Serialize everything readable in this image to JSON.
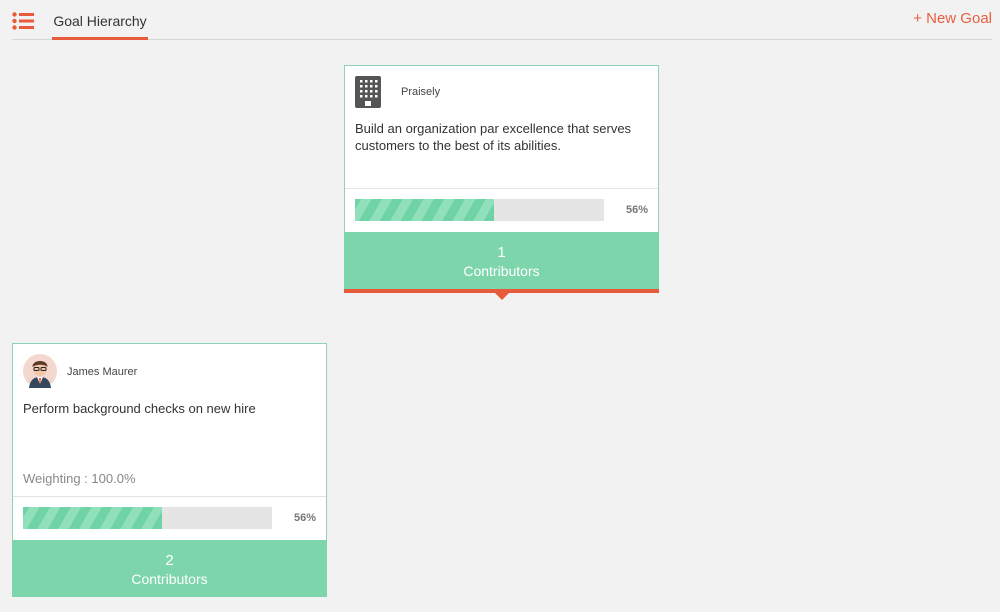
{
  "header": {
    "menu_icon": "list-icon",
    "tab_label": "Goal Hierarchy",
    "new_goal_label": "+ New Goal",
    "accent_color": "#e85a3c"
  },
  "goals": [
    {
      "owner": "Praisely",
      "owner_icon": "building-icon",
      "text": "Build an organization par excellence that serves customers to the best of its abilities.",
      "progress": 56,
      "progress_label": "56%",
      "contributors_count": "1",
      "contributors_label": "Contributors"
    },
    {
      "owner": "James Maurer",
      "owner_icon": "avatar",
      "text": "Perform background checks on new hire",
      "weighting": "Weighting : 100.0%",
      "progress": 56,
      "progress_label": "56%",
      "contributors_count": "2",
      "contributors_label": "Contributors"
    }
  ],
  "colors": {
    "card_border": "#8fd3b4",
    "contributors_bg": "#7dd5ab",
    "progress_fill": "#6fd3a5",
    "progress_track": "#e5e5e5"
  }
}
